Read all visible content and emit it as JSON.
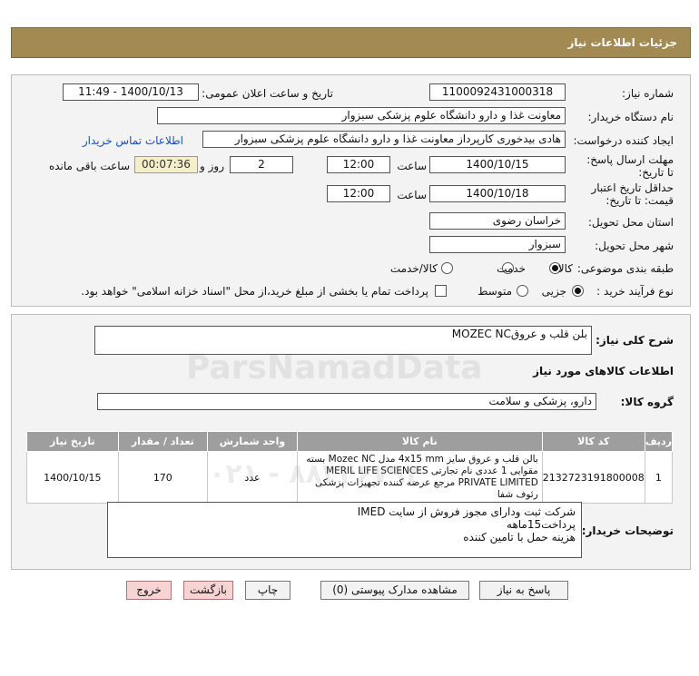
{
  "header": {
    "title": "جزئیات اطلاعات نیاز"
  },
  "fields": {
    "need_number_label": "شماره نیاز:",
    "need_number": "1100092431000318",
    "announce_label": "تاریخ و ساعت اعلان عمومی:",
    "announce_value": "1400/10/13 - 11:49",
    "buyer_org_label": "نام دستگاه خریدار:",
    "buyer_org": "معاونت غذا و دارو   دانشگاه علوم پزشکی سبزوار",
    "creator_label": "ایجاد کننده درخواست:",
    "creator": "هادی بیدخوری کارپرداز معاونت غذا و دارو   دانشگاه علوم پزشکی سبزوار",
    "contact_link": "اطلاعات تماس خریدار",
    "reply_deadline_label": "مهلت ارسال پاسخ: تا تاریخ:",
    "reply_date": "1400/10/15",
    "time_label": "ساعت",
    "reply_time": "12:00",
    "days_value": "2",
    "days_label": "روز و",
    "remaining_time": "00:07:36",
    "remaining_label": "ساعت باقی مانده",
    "validity_label": "حداقل تاریخ اعتبار قیمت: تا تاریخ:",
    "validity_date": "1400/10/18",
    "validity_time": "12:00",
    "province_label": "استان محل تحویل:",
    "province": "خراسان رضوی",
    "city_label": "شهر محل تحویل:",
    "city": "سبزوار",
    "category_label": "طبقه بندی موضوعی:",
    "category_options": [
      "کالا",
      "خدمت",
      "کالا/خدمت"
    ],
    "process_label": "نوع فرآیند خرید :",
    "process_options": [
      "جزیی",
      "متوسط"
    ],
    "payment_note": "پرداخت تمام یا بخشی از مبلغ خرید،از محل \"اسناد خزانه اسلامی\" خواهد بود."
  },
  "details": {
    "summary_label": "شرح کلی نیاز:",
    "summary": "بلن قلب و عروقMOZEC NC",
    "goods_info_title": "اطلاعات کالاهای مورد نیاز",
    "group_label": "گروه کالا:",
    "group": "دارو، پزشکی و سلامت",
    "table": {
      "headers": [
        "ردیف",
        "کد کالا",
        "نام کالا",
        "واحد شمارش",
        "تعداد / مقدار",
        "تاریخ نیاز"
      ],
      "rows": [
        {
          "row": "1",
          "code": "2132723191800008",
          "name": "بالن قلب و عروق سایز 4x15 mm مدل Mozec NC بسته مقوایی 1 عددی نام تجارتی MERIL LIFE SCIENCES PRIVATE LIMITED مرجع عرضه کننده تجهیزات پزشکی رئوف شفا",
          "unit": "عدد",
          "qty": "170",
          "date": "1400/10/15"
        }
      ]
    },
    "buyer_notes_label": "توضیحات خریدار:",
    "buyer_notes": [
      "شرکت ثبت ودارای مجوز فروش از سایت IMED",
      "پرداخت15ماهه",
      "هزینه حمل با تامین کننده"
    ]
  },
  "buttons": {
    "reply": "پاسخ به نیاز",
    "docs": "مشاهده مدارک پیوستی (0)",
    "print": "چاپ",
    "back": "بازگشت",
    "exit": "خروج"
  },
  "watermark": {
    "brand": "ParsNamadData",
    "phone": "۰۲۱ - ۸۸۳۴۶۷۹۳"
  }
}
